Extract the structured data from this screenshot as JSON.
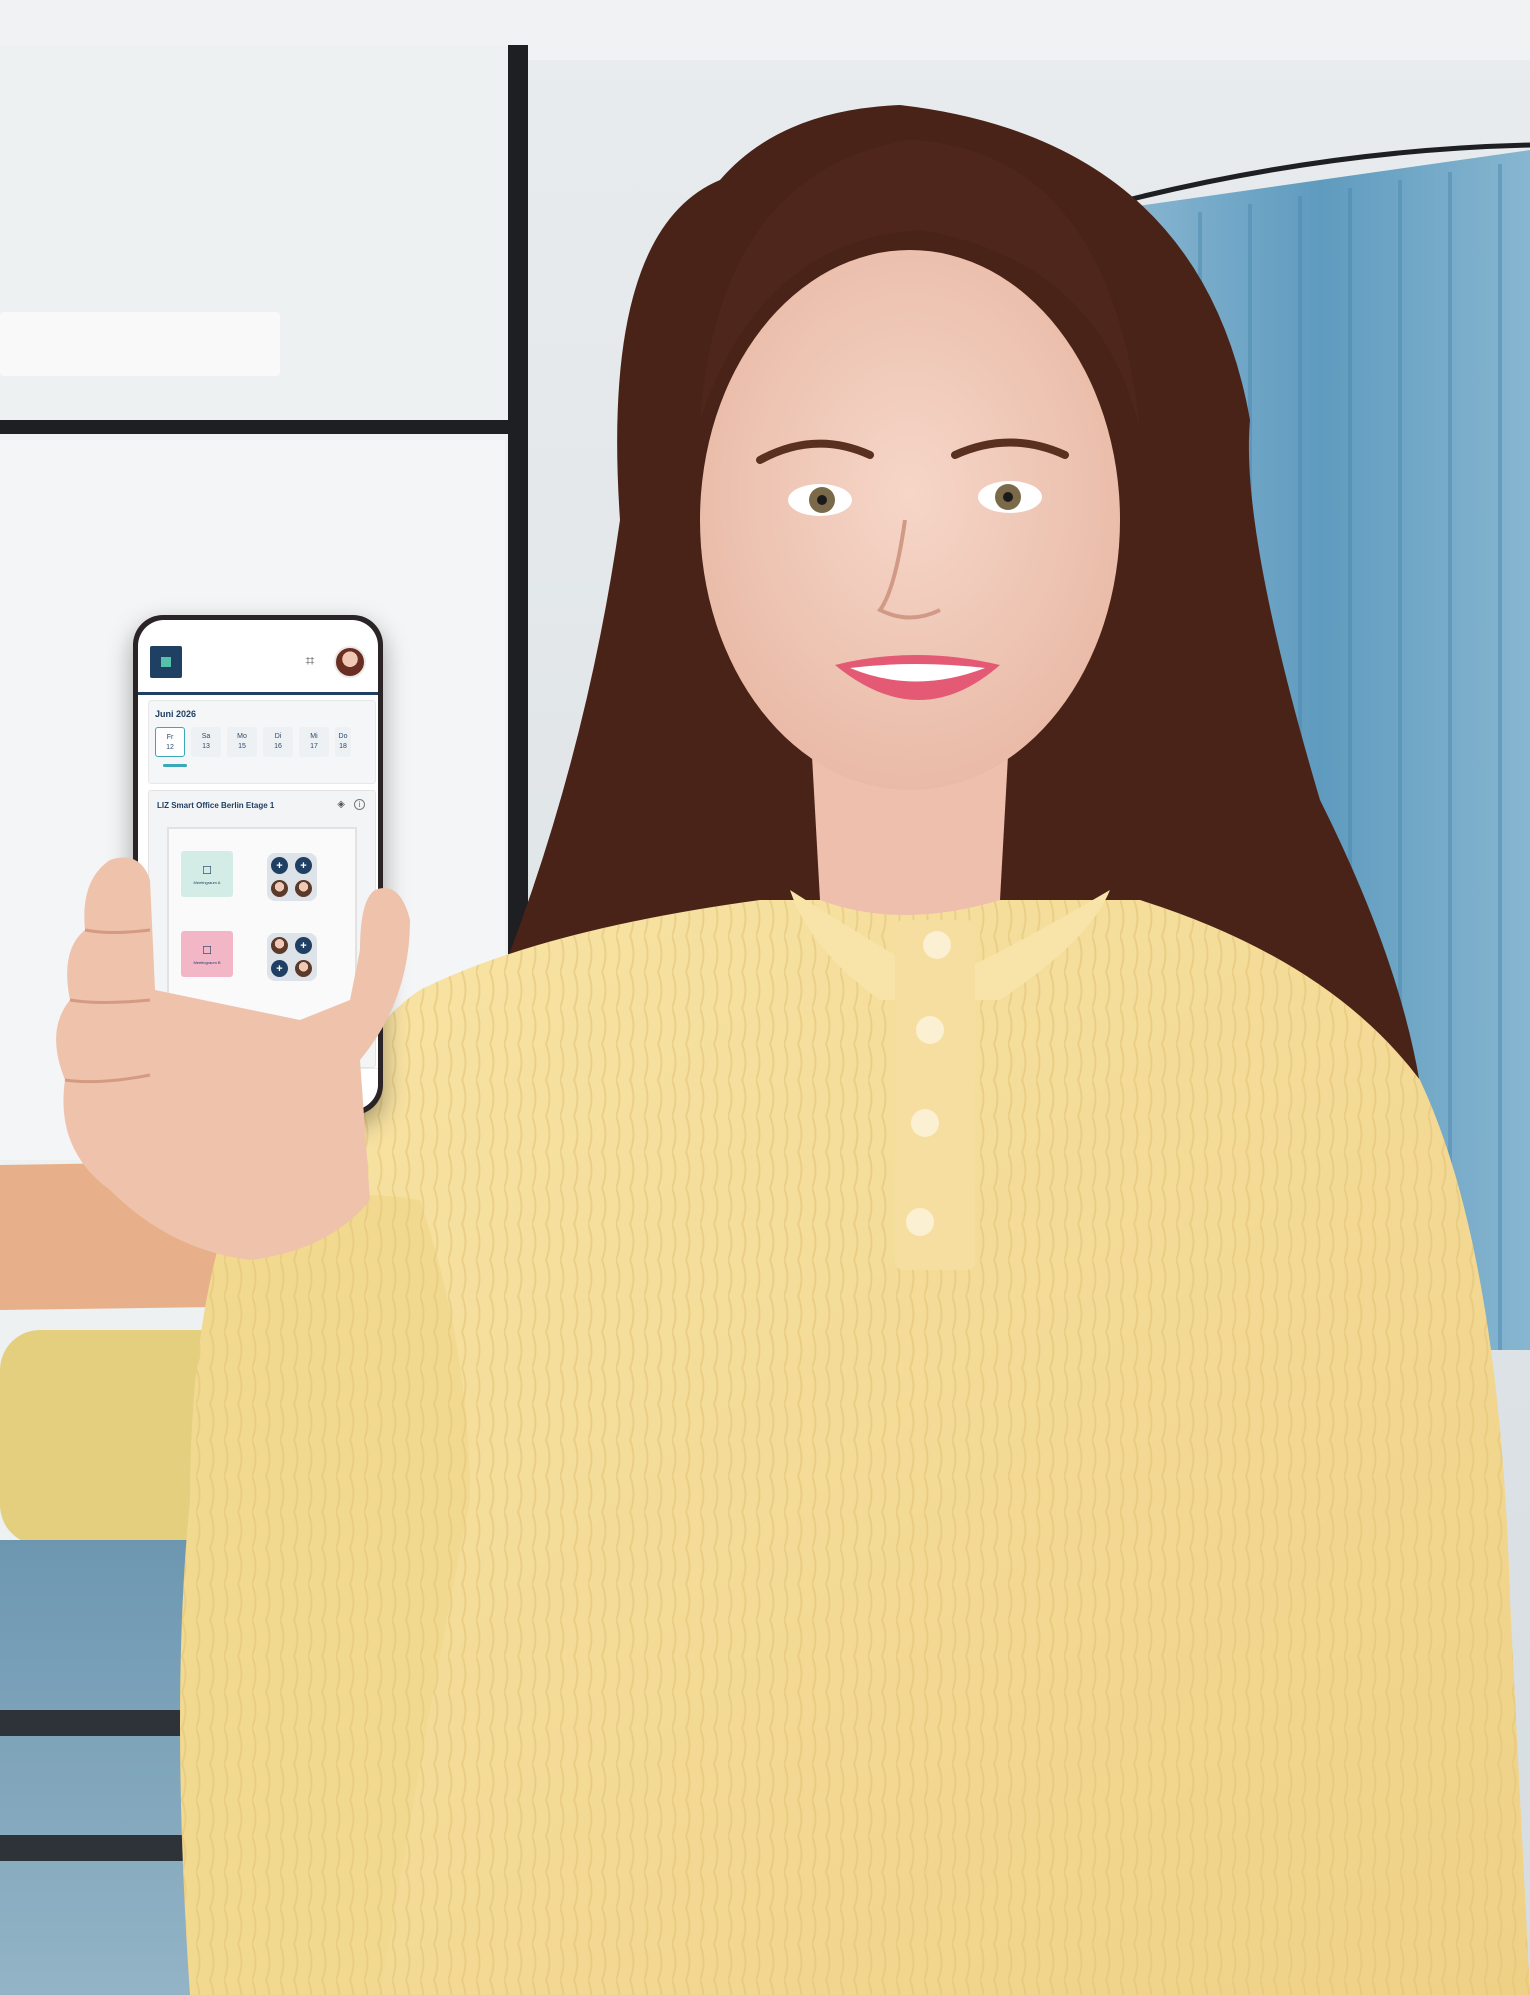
{
  "scene": {
    "description_colors": {
      "curtain": "#6aa3c4",
      "sweater": "#f4dd96",
      "hair": "#4a2318",
      "wall": "#e4e8ea",
      "table": "#e9b48f",
      "ottoman": "#e6d07e"
    }
  },
  "phone": {
    "header": {
      "logo_icon": "liz-logo-icon",
      "qr_icon": "qr-code-icon",
      "avatar": "user-avatar"
    },
    "calendar": {
      "month": "Juni 2026",
      "days": [
        {
          "weekday": "Fr",
          "date": "12"
        },
        {
          "weekday": "Sa",
          "date": "13"
        },
        {
          "weekday": "Mo",
          "date": "15"
        },
        {
          "weekday": "Di",
          "date": "16"
        },
        {
          "weekday": "Mi",
          "date": "17"
        },
        {
          "weekday": "Do",
          "date": "18"
        }
      ]
    },
    "floor": {
      "title": "LIZ Smart Office Berlin Etage 1",
      "rooms": [
        {
          "label": "Meetingraum A",
          "color": "#d3ece6"
        },
        {
          "label": "Meetingraum B",
          "color": "#f2b6c7"
        }
      ]
    },
    "nav": [
      {
        "icon": "home-icon",
        "glyph": "⌂"
      },
      {
        "icon": "map-icon",
        "glyph": "▮"
      },
      {
        "icon": "calendar-icon",
        "glyph": "▦"
      },
      {
        "icon": "team-icon",
        "glyph": "☺"
      },
      {
        "icon": "bell-icon",
        "glyph": "♪"
      }
    ]
  }
}
